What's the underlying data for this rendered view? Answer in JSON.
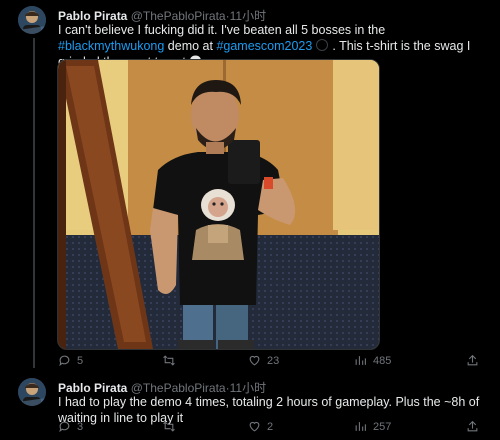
{
  "tweets": [
    {
      "name": "Pablo Pirata",
      "handle": "@ThePabloPirata",
      "dot": "·",
      "time": "11小时",
      "text_parts": {
        "p1": "I can't believe I fucking did it. I've beaten all 5 bosses in the",
        "hashtag1": "#blackmythwukong",
        "p2": " demo at ",
        "hashtag2": "#gamescom2023",
        "p3": ". This t-shirt is the swag I grinded the most to get"
      },
      "actions": {
        "replies": "5",
        "retweets": "",
        "likes": "23",
        "views": "485"
      }
    },
    {
      "name": "Pablo Pirata",
      "handle": "@ThePabloPirata",
      "dot": "·",
      "time": "11小时",
      "text": "I had to play the demo 4 times, totaling 2 hours of gameplay. Plus the ~8h of waiting in line to play it",
      "actions": {
        "replies": "3",
        "retweets": "",
        "likes": "2",
        "views": "257"
      }
    }
  ],
  "icons": {
    "reply": "reply-icon",
    "retweet": "retweet-icon",
    "like": "heart-icon",
    "views": "views-icon",
    "share": "share-icon",
    "skull": "skull-emoji"
  },
  "colors": {
    "background": "#000000",
    "text": "#e7e9ea",
    "muted": "#71767b",
    "link": "#1d9bf0"
  }
}
